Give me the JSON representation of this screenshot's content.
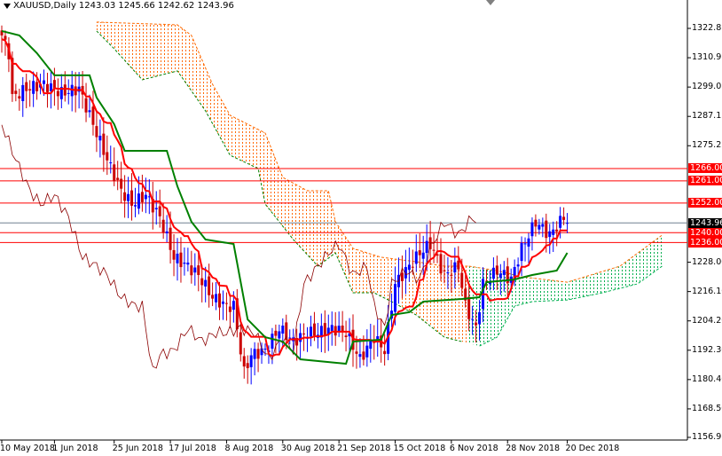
{
  "title": {
    "symbol": "XAUUSD,Daily",
    "ohlc": "1243.03 1245.66 1242.62 1243.96"
  },
  "colors": {
    "bull_candle": "#0000ff",
    "bear_candle": "#cc0000",
    "tenkan": "#ff0000",
    "kijun": "#008000",
    "chikou": "#8b0000",
    "cloud_bear": "#ff6a00",
    "cloud_bull": "#00b050",
    "level_line": "#ff0000",
    "current_line": "#708090"
  },
  "chart_data": {
    "type": "candlestick",
    "indicator": "Ichimoku",
    "ylim": [
      1156.95,
      1322.85
    ],
    "y_ticks": [
      "1322.85",
      "1310.95",
      "1299.05",
      "1287.15",
      "1275.25",
      "1228.00",
      "1216.10",
      "1204.20",
      "1192.30",
      "1180.40",
      "1168.50",
      "1156.95"
    ],
    "x_ticks": [
      {
        "bar": 0,
        "label": "10 May 2018"
      },
      {
        "bar": 15,
        "label": "1 Jun 2018"
      },
      {
        "bar": 32,
        "label": "25 Jun 2018"
      },
      {
        "bar": 48,
        "label": "17 Jul 2018"
      },
      {
        "bar": 64,
        "label": "8 Aug 2018"
      },
      {
        "bar": 80,
        "label": "30 Aug 2018"
      },
      {
        "bar": 96,
        "label": "21 Sep 2018"
      },
      {
        "bar": 112,
        "label": "15 Oct 2018"
      },
      {
        "bar": 128,
        "label": "6 Nov 2018"
      },
      {
        "bar": 144,
        "label": "28 Nov 2018"
      },
      {
        "bar": 161,
        "label": "20 Dec 2018"
      }
    ],
    "close_points": [
      [
        0,
        1320
      ],
      [
        2,
        1312.8
      ],
      [
        3,
        1294.8
      ],
      [
        7,
        1298.4
      ],
      [
        12,
        1300.2
      ],
      [
        17,
        1296.6
      ],
      [
        22,
        1298.4
      ],
      [
        26,
        1284
      ],
      [
        30,
        1269.6
      ],
      [
        34,
        1257
      ],
      [
        37,
        1251.6
      ],
      [
        41,
        1255.2
      ],
      [
        45,
        1246.2
      ],
      [
        49,
        1230
      ],
      [
        53,
        1226.4
      ],
      [
        56,
        1222.8
      ],
      [
        60,
        1213.8
      ],
      [
        64,
        1210.2
      ],
      [
        66,
        1210.2
      ],
      [
        69,
        1183.2
      ],
      [
        71,
        1190.4
      ],
      [
        75,
        1192.2
      ],
      [
        79,
        1201.2
      ],
      [
        83,
        1195.8
      ],
      [
        87,
        1199.4
      ],
      [
        90,
        1199.4
      ],
      [
        94,
        1201.2
      ],
      [
        98,
        1199.4
      ],
      [
        102,
        1188.6
      ],
      [
        106,
        1197.6
      ],
      [
        109,
        1192.2
      ],
      [
        112,
        1219.2
      ],
      [
        116,
        1226.4
      ],
      [
        119,
        1231.8
      ],
      [
        122,
        1235.4
      ],
      [
        126,
        1222.8
      ],
      [
        130,
        1226.4
      ],
      [
        132,
        1210.2
      ],
      [
        135,
        1201.2
      ],
      [
        137,
        1219.2
      ],
      [
        141,
        1224.6
      ],
      [
        145,
        1221
      ],
      [
        148,
        1233.6
      ],
      [
        152,
        1244.4
      ],
      [
        156,
        1239
      ],
      [
        160,
        1246.2
      ],
      [
        161,
        1243.96
      ]
    ],
    "kijun": [
      [
        0,
        1321.8
      ],
      [
        5,
        1320
      ],
      [
        10,
        1312.8
      ],
      [
        15,
        1303.8
      ],
      [
        25,
        1303.8
      ],
      [
        27,
        1294.8
      ],
      [
        32,
        1284
      ],
      [
        35,
        1273.2
      ],
      [
        47,
        1273.2
      ],
      [
        50,
        1258.8
      ],
      [
        54,
        1244.4
      ],
      [
        58,
        1237.2
      ],
      [
        66,
        1235.4
      ],
      [
        70,
        1204.8
      ],
      [
        75,
        1197.6
      ],
      [
        80,
        1195.8
      ],
      [
        85,
        1188.6
      ],
      [
        98,
        1186.8
      ],
      [
        100,
        1195.8
      ],
      [
        108,
        1196.6
      ],
      [
        111,
        1206.6
      ],
      [
        116,
        1207.7
      ],
      [
        120,
        1212
      ],
      [
        131,
        1213.1
      ],
      [
        136,
        1213.8
      ],
      [
        138,
        1219.9
      ],
      [
        146,
        1221
      ],
      [
        151,
        1222.8
      ],
      [
        158,
        1224.6
      ],
      [
        161,
        1231.8
      ]
    ],
    "cloud_upper": [
      [
        27,
        1325.4
      ],
      [
        50,
        1324.3
      ],
      [
        54,
        1320
      ],
      [
        60,
        1300.2
      ],
      [
        65,
        1287.6
      ],
      [
        75,
        1280.4
      ],
      [
        80,
        1262.4
      ],
      [
        87,
        1257
      ],
      [
        93,
        1257
      ],
      [
        95,
        1244.4
      ],
      [
        100,
        1233.6
      ],
      [
        108,
        1230
      ],
      [
        118,
        1228.2
      ],
      [
        126,
        1226.4
      ],
      [
        133,
        1226.4
      ],
      [
        141,
        1224.6
      ],
      [
        148,
        1222.1
      ],
      [
        161,
        1219.9
      ],
      [
        176,
        1226.4
      ],
      [
        188,
        1239
      ]
    ],
    "cloud_lower": [
      [
        27,
        1321.8
      ],
      [
        32,
        1314.6
      ],
      [
        40,
        1302
      ],
      [
        50,
        1305.6
      ],
      [
        58,
        1289.4
      ],
      [
        65,
        1271.4
      ],
      [
        73,
        1266
      ],
      [
        75,
        1251.6
      ],
      [
        83,
        1237.2
      ],
      [
        90,
        1226.4
      ],
      [
        95,
        1231.8
      ],
      [
        100,
        1215.6
      ],
      [
        106,
        1215.6
      ],
      [
        111,
        1212
      ],
      [
        118,
        1206.6
      ],
      [
        126,
        1197.6
      ],
      [
        131,
        1195.8
      ],
      [
        136,
        1194
      ],
      [
        141,
        1197.6
      ],
      [
        146,
        1210.2
      ],
      [
        151,
        1212
      ],
      [
        161,
        1212.7
      ],
      [
        171,
        1215.6
      ],
      [
        181,
        1219.2
      ],
      [
        188,
        1226.4
      ]
    ],
    "cloud_switch_bar": 133,
    "levels": [
      {
        "price": "1266.00",
        "kind": "resistance"
      },
      {
        "price": "1261.00",
        "kind": "resistance"
      },
      {
        "price": "1252.00",
        "kind": "resistance"
      },
      {
        "price": "1243.96",
        "kind": "current"
      },
      {
        "price": "1240.00",
        "kind": "support"
      },
      {
        "price": "1236.00",
        "kind": "support"
      }
    ]
  }
}
